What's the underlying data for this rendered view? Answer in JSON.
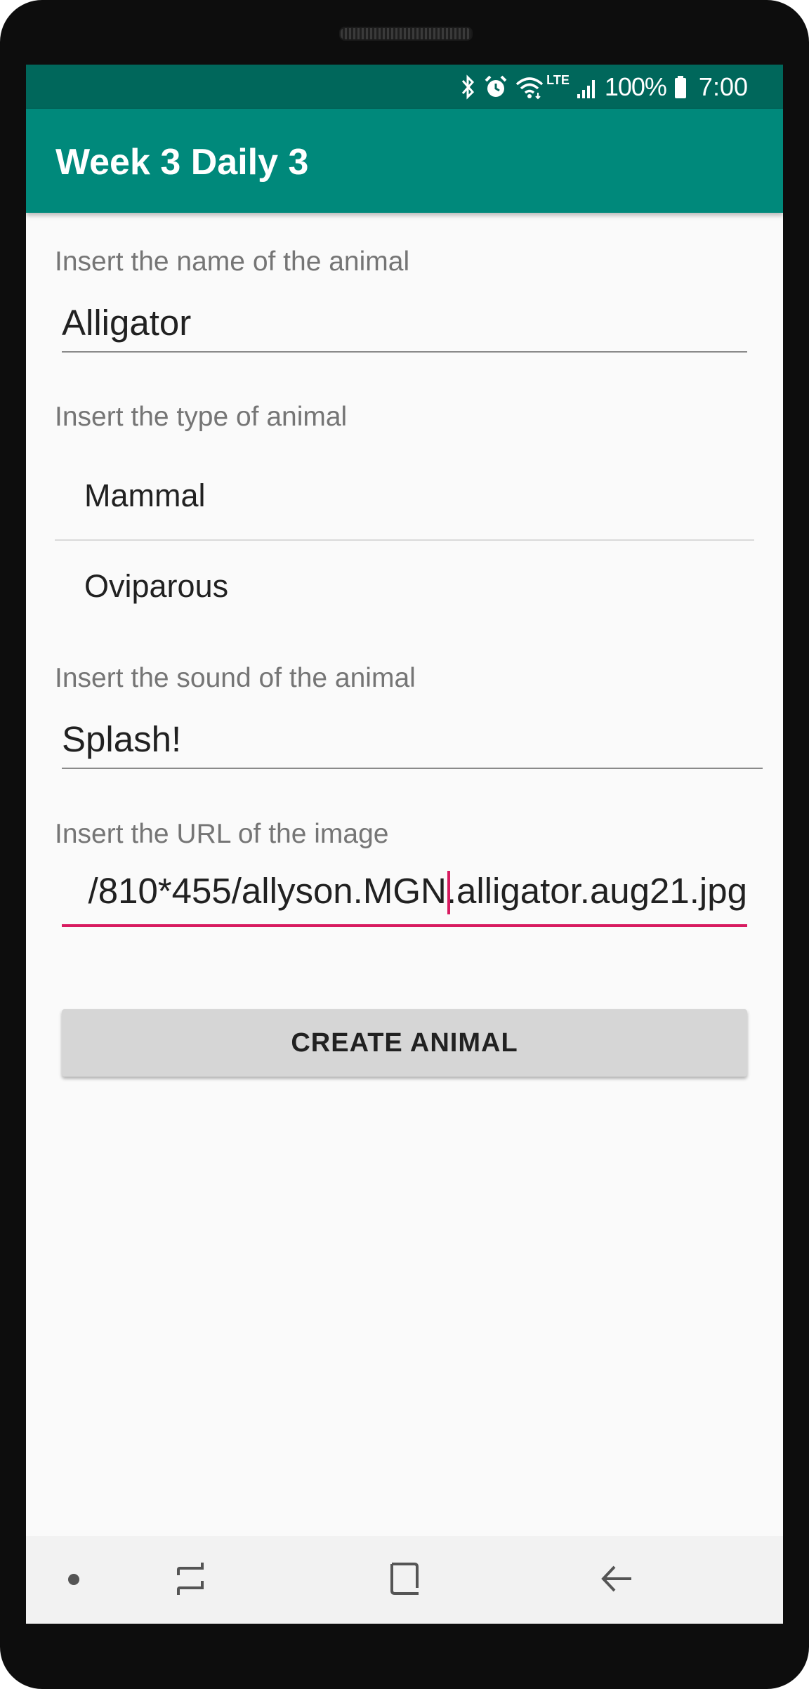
{
  "status_bar": {
    "icons": [
      "bluetooth-icon",
      "alarm-icon",
      "wifi-icon",
      "lte-icon",
      "signal-icon",
      "battery-icon"
    ],
    "lte_label": "LTE",
    "battery": "100%",
    "time": "7:00"
  },
  "app_bar": {
    "title": "Week 3 Daily 3"
  },
  "form": {
    "name_label": "Insert the name of the animal",
    "name_value": "Alligator",
    "type_label": "Insert the type of animal",
    "type_options": [
      "Mammal",
      "Oviparous"
    ],
    "sound_label": "Insert the sound of the animal",
    "sound_value": "Splash!",
    "url_label": "Insert the URL of the image",
    "url_value": "/810*455/allyson.MGN.alligator.aug21.jpg",
    "create_button": "CREATE ANIMAL"
  },
  "nav_bar": {
    "icons": [
      "dot-icon",
      "recent-apps-icon",
      "home-icon",
      "back-icon"
    ]
  },
  "colors": {
    "status_bar": "#00675b",
    "app_bar": "#00897b",
    "accent": "#d81b60",
    "button": "#d6d6d6"
  }
}
